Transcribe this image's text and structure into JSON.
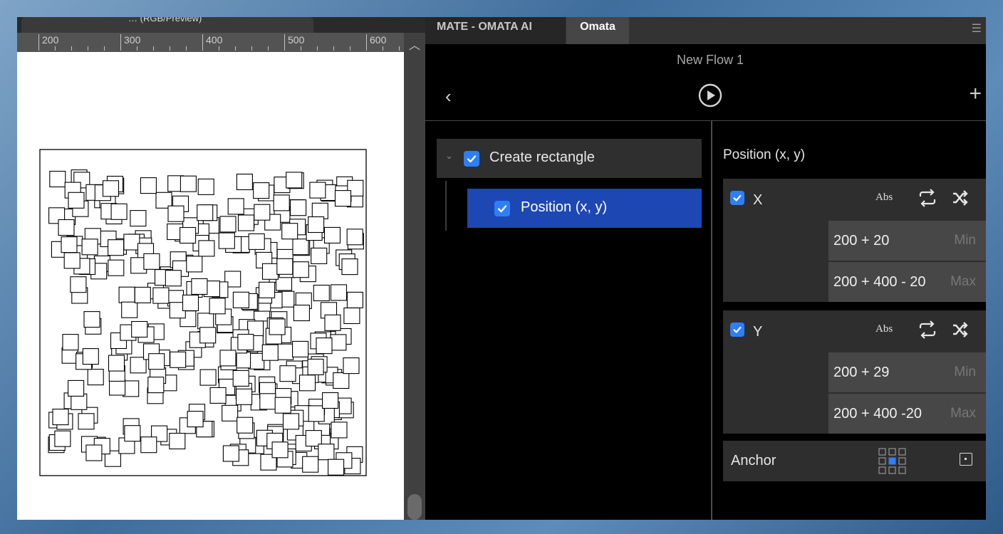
{
  "document": {
    "tab_title": "…   (RGB/Preview)",
    "ruler_labels": [
      "200",
      "300",
      "400",
      "500",
      "600"
    ]
  },
  "panel": {
    "tabs": [
      "MATE - OMATA AI",
      "Omata"
    ],
    "active_tab": "Omata",
    "flow_title": "New Flow 1",
    "tree": {
      "parent_label": "Create rectangle",
      "child_label": "Position (x, y)"
    },
    "properties": {
      "title": "Position (x, y)",
      "x": {
        "label": "X",
        "mode": "Abs",
        "min_value": "200 + 20",
        "min_tag": "Min",
        "max_value": "200 + 400 - 20",
        "max_tag": "Max"
      },
      "y": {
        "label": "Y",
        "mode": "Abs",
        "min_value": "200 + 29",
        "min_tag": "Min",
        "max_value": "200 + 400 -20",
        "max_tag": "Max"
      },
      "anchor_label": "Anchor"
    }
  },
  "colors": {
    "accent": "#2d7ff9",
    "selection": "#1d48b4",
    "panel_bg": "#000000",
    "row_bg": "#2e2e2e"
  }
}
